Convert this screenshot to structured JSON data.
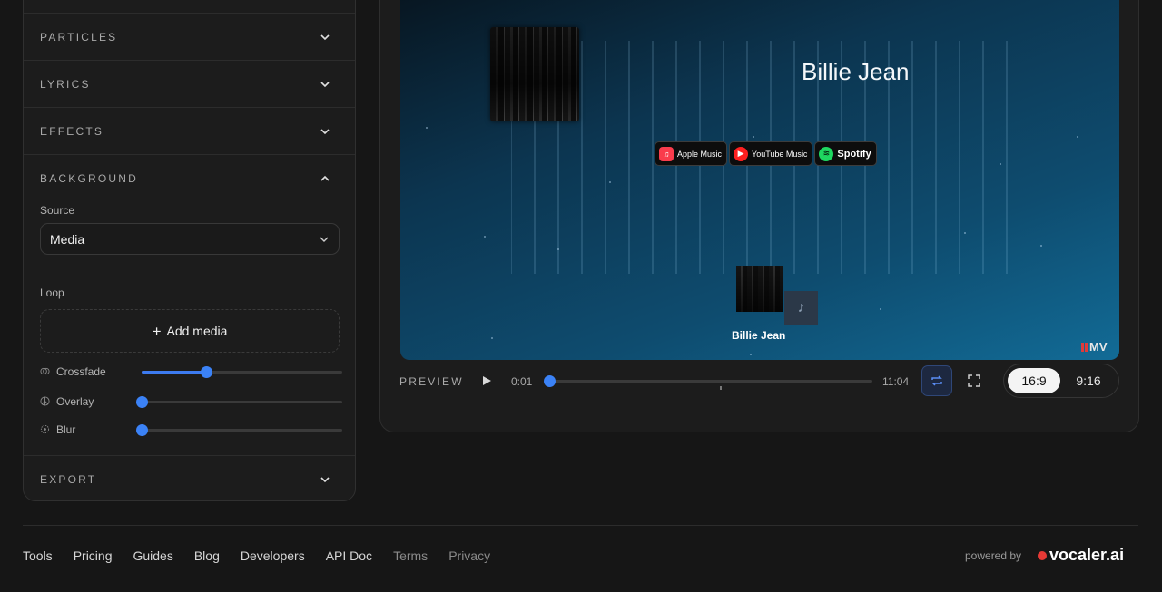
{
  "sidebar": {
    "sections": [
      {
        "label": "PARTICLES",
        "expanded": false
      },
      {
        "label": "LYRICS",
        "expanded": false
      },
      {
        "label": "EFFECTS",
        "expanded": false
      },
      {
        "label": "BACKGROUND",
        "expanded": true
      },
      {
        "label": "EXPORT",
        "expanded": false
      }
    ],
    "background": {
      "source_label": "Source",
      "source_value": "Media",
      "loop_label": "Loop",
      "add_media_label": "Add media",
      "sliders": [
        {
          "label": "Crossfade",
          "icon": "crossfade-icon",
          "value": 0.32
        },
        {
          "label": "Overlay",
          "icon": "overlay-icon",
          "value": 0
        },
        {
          "label": "Blur",
          "icon": "blur-icon",
          "value": 0
        }
      ]
    }
  },
  "preview": {
    "song_title": "Billie Jean",
    "small_title": "Billie Jean",
    "badges": [
      {
        "label": "Apple Music",
        "color": "#fa3c4c",
        "icon": "apple-music-icon"
      },
      {
        "label": "YouTube Music",
        "color": "#ff2020",
        "icon": "youtube-music-icon"
      },
      {
        "label": "Spotify",
        "color": "#1ed760",
        "icon": "spotify-icon"
      }
    ],
    "watermark": "MV",
    "label": "PREVIEW",
    "current_time": "0:01",
    "total_time": "11:04",
    "progress": 0,
    "ratios": [
      {
        "label": "16:9",
        "active": true
      },
      {
        "label": "9:16",
        "active": false
      }
    ]
  },
  "footer": {
    "links": [
      {
        "label": "Tools",
        "dim": false
      },
      {
        "label": "Pricing",
        "dim": false
      },
      {
        "label": "Guides",
        "dim": false
      },
      {
        "label": "Blog",
        "dim": false
      },
      {
        "label": "Developers",
        "dim": false
      },
      {
        "label": "API Doc",
        "dim": false
      },
      {
        "label": "Terms",
        "dim": true
      },
      {
        "label": "Privacy",
        "dim": true
      }
    ],
    "powered_by": "powered by",
    "brand": "vocaler.ai"
  },
  "colors": {
    "accent": "#3b82f6",
    "brand_dot": "#e53935"
  }
}
